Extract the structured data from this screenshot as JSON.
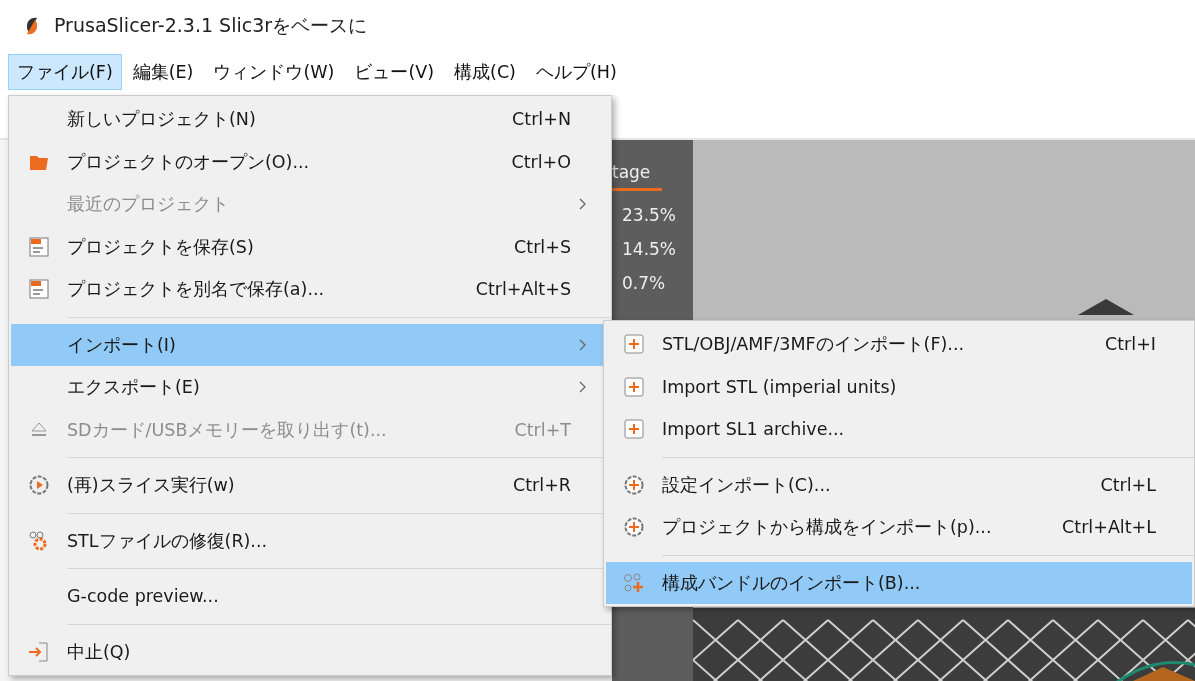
{
  "window": {
    "title": "PrusaSlicer-2.3.1 Slic3rをベースに"
  },
  "menubar": [
    {
      "label": "ファイル(F)",
      "selected": true
    },
    {
      "label": "編集(E)",
      "selected": false
    },
    {
      "label": "ウィンドウ(W)",
      "selected": false
    },
    {
      "label": "ビュー(V)",
      "selected": false
    },
    {
      "label": "構成(C)",
      "selected": false
    },
    {
      "label": "ヘルプ(H)",
      "selected": false
    }
  ],
  "legend": {
    "header": "tage",
    "values": [
      "23.5%",
      "14.5%",
      "0.7%"
    ]
  },
  "file_menu": {
    "items": [
      {
        "kind": "item",
        "label": "新しいプロジェクト(N)",
        "shortcut": "Ctrl+N",
        "disabled": false,
        "selected": false,
        "submenu": false
      },
      {
        "kind": "item",
        "label": "プロジェクトのオープン(O)...",
        "shortcut": "Ctrl+O",
        "disabled": false,
        "selected": false,
        "submenu": false
      },
      {
        "kind": "item",
        "label": "最近のプロジェクト",
        "disabled": true,
        "selected": false,
        "submenu": true
      },
      {
        "kind": "item",
        "label": "プロジェクトを保存(S)",
        "shortcut": "Ctrl+S",
        "disabled": false,
        "selected": false,
        "submenu": false
      },
      {
        "kind": "item",
        "label": "プロジェクトを別名で保存(a)...",
        "shortcut": "Ctrl+Alt+S",
        "disabled": false,
        "selected": false,
        "submenu": false
      },
      {
        "kind": "separator"
      },
      {
        "kind": "item",
        "label": "インポート(I)",
        "disabled": false,
        "selected": true,
        "submenu": true
      },
      {
        "kind": "item",
        "label": "エクスポート(E)",
        "disabled": false,
        "selected": false,
        "submenu": true
      },
      {
        "kind": "item",
        "label": "SDカード/USBメモリーを取り出す(t)...",
        "shortcut": "Ctrl+T",
        "disabled": true,
        "selected": false,
        "submenu": false
      },
      {
        "kind": "separator"
      },
      {
        "kind": "item",
        "label": "(再)スライス実行(w)",
        "shortcut": "Ctrl+R",
        "disabled": false,
        "selected": false,
        "submenu": false
      },
      {
        "kind": "separator"
      },
      {
        "kind": "item",
        "label": "STLファイルの修復(R)...",
        "disabled": false,
        "selected": false,
        "submenu": false
      },
      {
        "kind": "separator"
      },
      {
        "kind": "item",
        "label": "G-code preview...",
        "disabled": false,
        "selected": false,
        "submenu": false
      },
      {
        "kind": "separator"
      },
      {
        "kind": "item",
        "label": "中止(Q)",
        "disabled": false,
        "selected": false,
        "submenu": false
      }
    ]
  },
  "import_submenu": {
    "items": [
      {
        "kind": "item",
        "label": "STL/OBJ/AMF/3MFのインポート(F)...",
        "shortcut": "Ctrl+I",
        "disabled": false,
        "selected": false,
        "submenu": false
      },
      {
        "kind": "item",
        "label": "Import STL (imperial units)",
        "disabled": false,
        "selected": false,
        "submenu": false
      },
      {
        "kind": "item",
        "label": "Import SL1 archive...",
        "disabled": false,
        "selected": false,
        "submenu": false
      },
      {
        "kind": "separator"
      },
      {
        "kind": "item",
        "label": "設定インポート(C)...",
        "shortcut": "Ctrl+L",
        "disabled": false,
        "selected": false,
        "submenu": false
      },
      {
        "kind": "item",
        "label": "プロジェクトから構成をインポート(p)...",
        "shortcut": "Ctrl+Alt+L",
        "disabled": false,
        "selected": false,
        "submenu": false
      },
      {
        "kind": "separator"
      },
      {
        "kind": "item",
        "label": "構成バンドルのインポート(B)...",
        "disabled": false,
        "selected": true,
        "submenu": false
      }
    ]
  }
}
